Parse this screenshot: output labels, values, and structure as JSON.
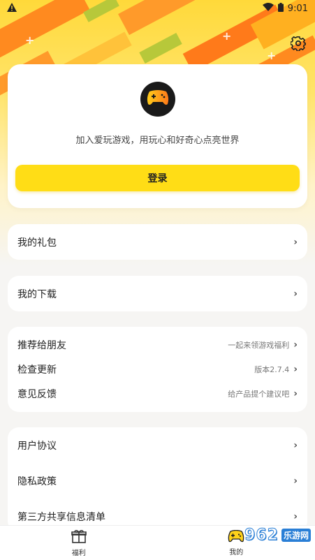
{
  "status_bar": {
    "time": "9:01"
  },
  "profile": {
    "tagline": "加入爱玩游戏，用玩心和好奇心点亮世界",
    "login_label": "登录"
  },
  "menu": {
    "gifts": "我的礼包",
    "downloads": "我的下载",
    "group1": [
      {
        "label": "推荐给朋友",
        "sub": "一起来领游戏福利"
      },
      {
        "label": "检查更新",
        "sub": "版本2.7.4"
      },
      {
        "label": "意见反馈",
        "sub": "给产品提个建议吧"
      }
    ],
    "group2": [
      {
        "label": "用户协议"
      },
      {
        "label": "隐私政策"
      },
      {
        "label": "第三方共享信息清单"
      }
    ]
  },
  "bottom_nav": [
    {
      "label": "福利",
      "icon": "gift-icon"
    },
    {
      "label": "我的",
      "icon": "gamepad-icon"
    }
  ],
  "watermark": {
    "badge": "962",
    "text": "乐游网"
  },
  "colors": {
    "accent": "#ffdd16",
    "header": "#ffd93a",
    "orange": "#ff8a1f"
  }
}
